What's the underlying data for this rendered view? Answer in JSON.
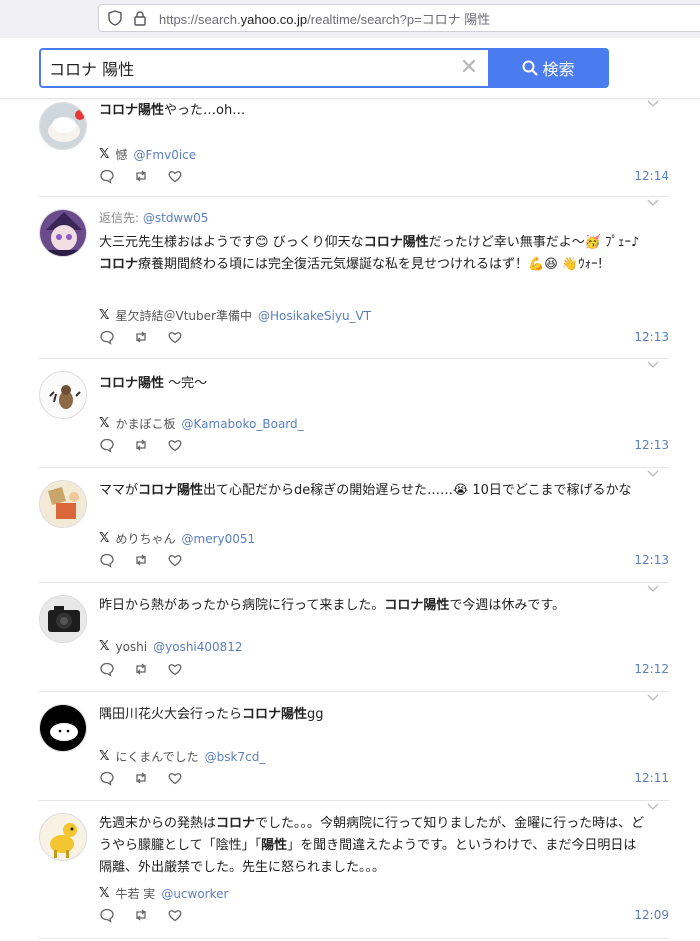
{
  "browser": {
    "url_prefix": "https://search.",
    "url_host": "yahoo.co.jp",
    "url_path": "/realtime/search?p=コロナ 陽性"
  },
  "search": {
    "query": "コロナ 陽性",
    "button_label": "検索"
  },
  "tweets": [
    {
      "reply_to_label": "",
      "reply_to_handle": "",
      "text_parts": [
        {
          "t": "コロナ陽性",
          "b": true
        },
        {
          "t": "やった…oh…",
          "b": false
        }
      ],
      "author": "憾",
      "handle": "@Fmv0ice",
      "time": "12:14"
    },
    {
      "reply_to_label": "返信先:",
      "reply_to_handle": "@stdww05",
      "text_parts": [
        {
          "t": "大三元先生様おはようです😊 びっくり仰天な",
          "b": false
        },
        {
          "t": "コロナ陽性",
          "b": true
        },
        {
          "t": "だったけど幸い無事だよ〜🥳 ﾌﾟｪｰ♪ ",
          "b": false
        },
        {
          "t": "コロナ",
          "b": true
        },
        {
          "t": "療養期間終わる頃には完全復活元気爆誕な私を見せつけれるはず！💪😆 👋ｳｫｰ!",
          "b": false
        }
      ],
      "author": "星欠詩結＠Vtuber準備中",
      "handle": "@HosikakeSiyu_VT",
      "time": "12:13"
    },
    {
      "reply_to_label": "",
      "reply_to_handle": "",
      "text_parts": [
        {
          "t": "コロナ陽性",
          "b": true
        },
        {
          "t": " 〜完〜",
          "b": false
        }
      ],
      "author": "かまぼこ板",
      "handle": "@Kamaboko_Board_",
      "time": "12:13"
    },
    {
      "reply_to_label": "",
      "reply_to_handle": "",
      "text_parts": [
        {
          "t": "ママが",
          "b": false
        },
        {
          "t": "コロナ陽性",
          "b": true
        },
        {
          "t": "出て心配だからde稼ぎの開始遅らせた……😭 10日でどこまで稼げるかな",
          "b": false
        }
      ],
      "author": "めりちゃん",
      "handle": "@mery0051",
      "time": "12:13"
    },
    {
      "reply_to_label": "",
      "reply_to_handle": "",
      "text_parts": [
        {
          "t": "昨日から熱があったから病院に行って来ました。",
          "b": false
        },
        {
          "t": "コロナ陽性",
          "b": true
        },
        {
          "t": "で今週は休みです。",
          "b": false
        }
      ],
      "author": "yoshi",
      "handle": "@yoshi400812",
      "time": "12:12"
    },
    {
      "reply_to_label": "",
      "reply_to_handle": "",
      "text_parts": [
        {
          "t": "隅田川花火大会行ったら",
          "b": false
        },
        {
          "t": "コロナ陽性",
          "b": true
        },
        {
          "t": "gg",
          "b": false
        }
      ],
      "author": "にくまんでした",
      "handle": "@bsk7cd_",
      "time": "12:11"
    },
    {
      "reply_to_label": "",
      "reply_to_handle": "",
      "text_parts": [
        {
          "t": "先週末からの発熱は",
          "b": false
        },
        {
          "t": "コロナ",
          "b": true
        },
        {
          "t": "でした。。。今朝病院に行って知りましたが、金曜に行った時は、どうやら朦朧として「陰性」「",
          "b": false
        },
        {
          "t": "陽性",
          "b": true
        },
        {
          "t": "」を聞き間違えたようです。というわけで、まだ今日明日は隔離、外出厳禁でした。先生に怒られました。。。",
          "b": false
        }
      ],
      "author": "牛若 実",
      "handle": "@ucworker",
      "time": "12:09"
    }
  ]
}
